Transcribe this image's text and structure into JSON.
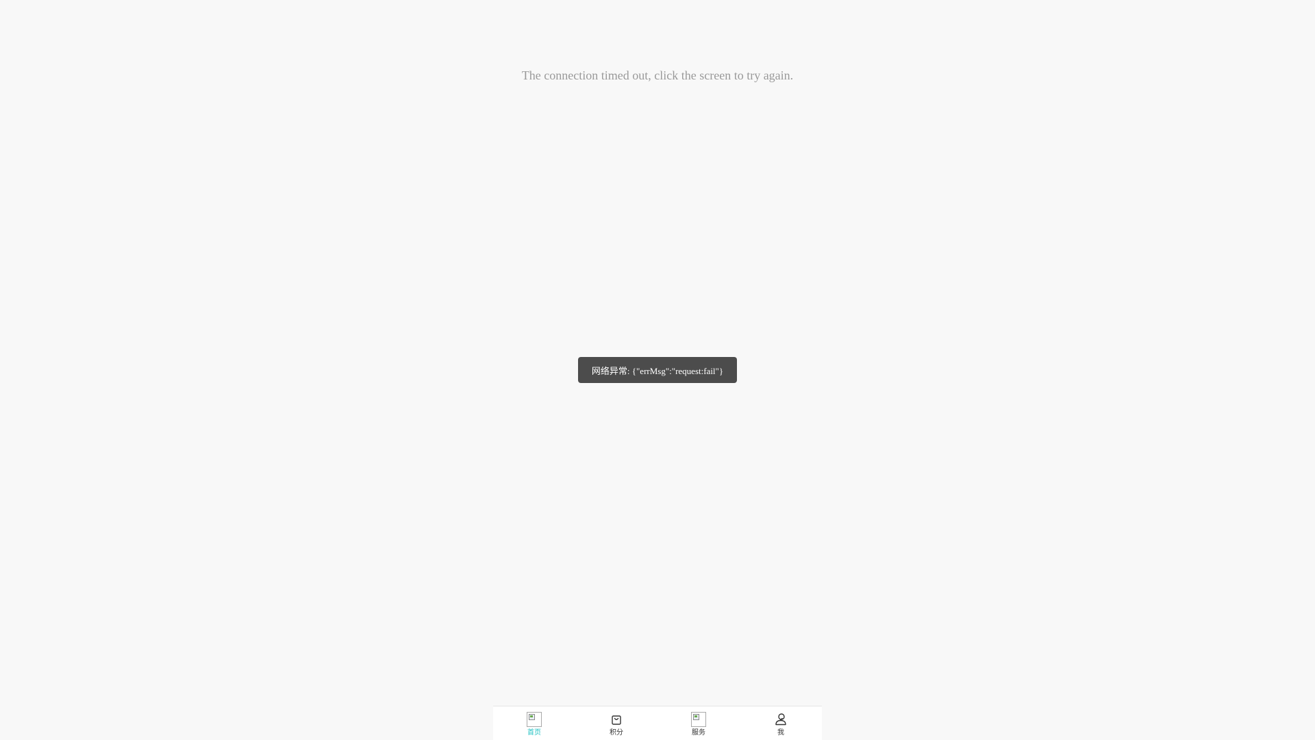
{
  "message": {
    "timeout": "The connection timed out, click the screen to try again."
  },
  "toast": {
    "text": "网络异常: {\"errMsg\":\"request:fail\"}"
  },
  "tabbar": {
    "accent_color": "#22c1c3",
    "tabs": [
      {
        "label": "首页",
        "icon": "broken-image-icon",
        "active": true
      },
      {
        "label": "积分",
        "icon": "shopping-bag-icon",
        "active": false
      },
      {
        "label": "服务",
        "icon": "broken-image-icon",
        "active": false
      },
      {
        "label": "我",
        "icon": "user-icon",
        "active": false
      }
    ]
  }
}
